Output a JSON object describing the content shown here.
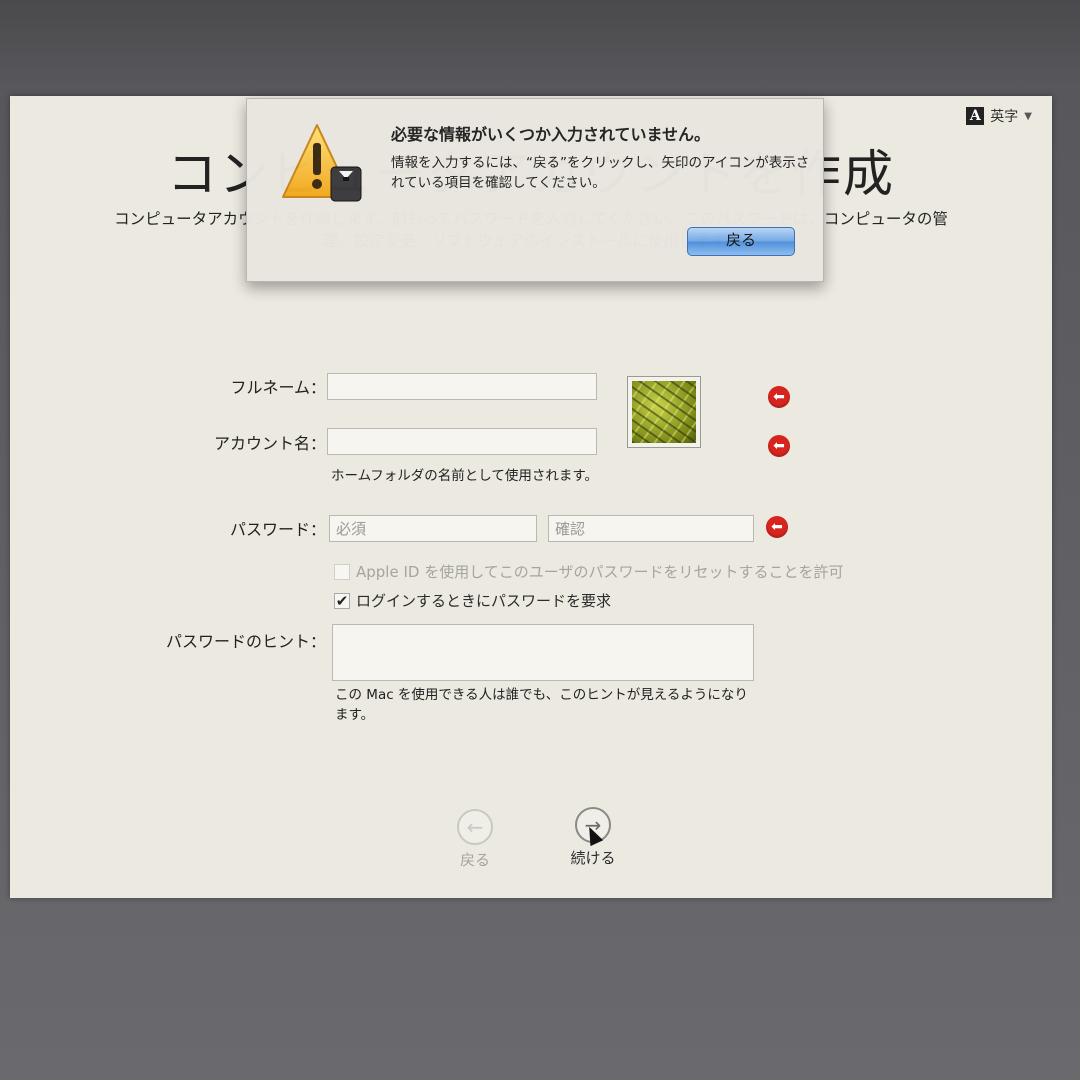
{
  "ime": {
    "icon_letter": "A",
    "label": "英字"
  },
  "page": {
    "title": "コンピュータアカウントを作成",
    "subtitle": "コンピュータアカウントを作成します。前もってパスワードを入力してください。このパスワードは、コンピュータの管理、設定変更、ソフトウェアのインストールに使用します。"
  },
  "form": {
    "full_name_label": "フルネーム：",
    "full_name_value": "",
    "account_name_label": "アカウント名：",
    "account_name_value": "",
    "account_note": "ホームフォルダの名前として使用されます。",
    "password_label": "パスワード：",
    "password_placeholder": "必須",
    "verify_placeholder": "確認",
    "apple_id_checkbox": "Apple ID を使用してこのユーザのパスワードをリセットすることを許可",
    "apple_id_checked": false,
    "require_password_checkbox": "ログインするときにパスワードを要求",
    "require_password_checked": true,
    "hint_label": "パスワードのヒント：",
    "hint_value": "",
    "hint_note": "この Mac を使用できる人は誰でも、このヒントが見えるようになります。"
  },
  "nav": {
    "back_label": "戻る",
    "continue_label": "続ける"
  },
  "alert": {
    "title": "必要な情報がいくつか入力されていません。",
    "body": "情報を入力するには、“戻る”をクリックし、矢印のアイコンが表示されている項目を確認してください。",
    "button_label": "戻る"
  },
  "colors": {
    "error_red": "#d8241f",
    "default_button_blue": "#4f8fdc",
    "background": "#ebe9e0"
  },
  "icons": {
    "error": "left-arrow-error-icon",
    "alert": "caution-triangle-icon",
    "back": "left-arrow-circle-icon",
    "continue": "right-arrow-circle-icon"
  }
}
